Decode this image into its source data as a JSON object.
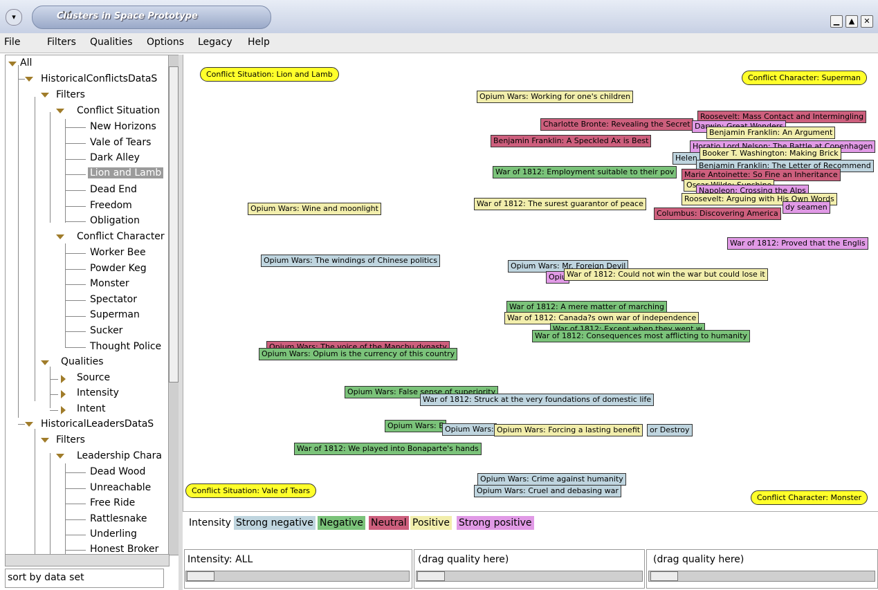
{
  "window": {
    "title": "Clusters in Space Prototype"
  },
  "menubar": [
    "File",
    "Filters",
    "Qualities",
    "Options",
    "Legacy",
    "Help"
  ],
  "tree": {
    "items": [
      "All",
      "HistoricalConflictsDataS",
      "Filters",
      "Conflict Situation",
      "New Horizons",
      "Vale of Tears",
      "Dark Alley",
      "Lion and Lamb",
      "Dead End",
      "Freedom",
      "Obligation",
      "Conflict Character",
      "Worker Bee",
      "Powder Keg",
      "Monster",
      "Spectator",
      "Superman",
      "Sucker",
      "Thought Police",
      "Qualities",
      "Source",
      "Intensity",
      "Intent",
      "HistoricalLeadersDataS",
      "Filters",
      "Leadership Chara",
      "Dead Wood",
      "Unreachable",
      "Free Ride",
      "Rattlesnake",
      "Underling",
      "Honest Broker"
    ],
    "selected": "Lion and Lamb",
    "sort_label": "sort by data set"
  },
  "colors": {
    "strong_negative": "#bfd5df",
    "negative": "#7bc37a",
    "neutral": "#cd5f7d",
    "positive": "#f2eeac",
    "strong_positive": "#e19ae6",
    "anchor": "#ffff2b"
  },
  "anchors": [
    "Conflict Situation: Lion and Lamb",
    "Conflict Character: Superman",
    "Conflict Situation: Vale of Tears",
    "Conflict Character: Monster"
  ],
  "cards": [
    "Opium Wars: Working for one's children",
    "Roosevelt: Mass Contact and Intermingling",
    "Charlotte Bronte: Revealing the Secret",
    "Darwin: Great Wonders",
    "Benjamin Franklin: An Argument",
    "Benjamin Franklin: A Speckled Ax is Best",
    "Horatio Lord Nelson: The Battle at Copenhagen",
    "Booker T. Washington: Making Brick",
    "Helen",
    "Benjamin Franklin: The Letter of Recommend",
    "War of 1812: Employment suitable to their pov",
    "Marie Antoinette: So Fine an Inheritance",
    "Oscar Wilde: Sunshine",
    "Napoleon: Crossing the Alps",
    "War of 1812: The surest guarantor of peace",
    "Roosevelt: Arguing with His Own Words",
    "Columbus: Discovering America",
    "dy seamen",
    "Opium Wars: Wine and moonlight",
    "War of 1812: Proved that the Englis",
    "Opium Wars: The windings of Chinese politics",
    "Opium Wars: Mr. Foreign Devil",
    "Opiu",
    "War of 1812: Could not win the war but could lose it",
    "War of 1812: A mere matter of marching",
    "War of 1812: Canada?s own war of independence",
    "War of 1812: Except when they went w",
    "War of 1812: Consequences most afflicting to humanity",
    "Opium Wars: The voice of the Manchu dynasty",
    "Opium Wars: Opium is the currency of this country",
    "Opium Wars: False sense of superiority",
    "War of 1812: Struck at the very foundations of domestic life",
    "Opium Wars: E",
    "Opium Wars:",
    "Opium Wars: Forcing a lasting benefit",
    "or Destroy",
    "War of 1812: We played into Bonaparte's hands",
    "Opium Wars: Crime against humanity",
    "Opium Wars: Cruel and debasing war"
  ],
  "legend": {
    "title": "Intensity",
    "items": [
      "Strong negative",
      "Negative",
      "Neutral",
      "Positive",
      "Strong positive"
    ]
  },
  "qualities": {
    "slot1": "Intensity: ALL",
    "slot2": "(drag quality here)",
    "slot3": "(drag quality here)"
  }
}
